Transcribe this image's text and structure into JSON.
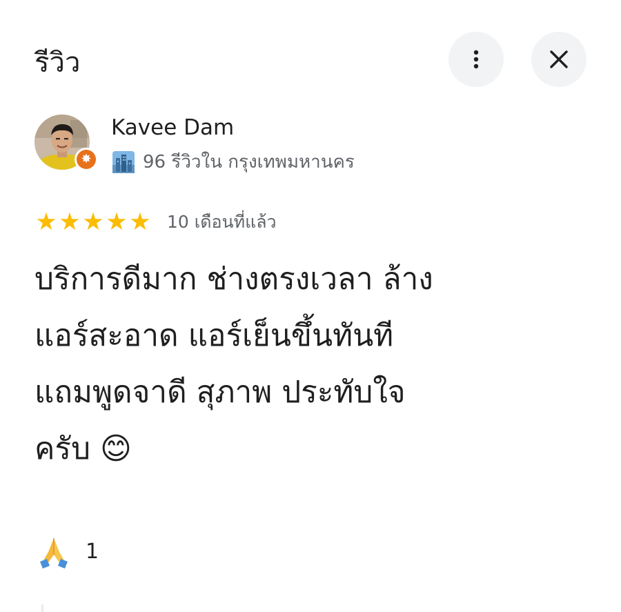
{
  "header": {
    "title": "รีวิว",
    "more_icon": "more-vertical-icon",
    "close_icon": "close-icon"
  },
  "reviewer": {
    "name": "Kavee Dam",
    "badge_icon": "local-guide-badge-icon",
    "meta_icon": "cityscape-icon",
    "meta": "96 รีวิวใน กรุงเทพมหานคร"
  },
  "review": {
    "rating": 5,
    "max_rating": 5,
    "date": "10 เดือนที่แล้ว",
    "text": "บริการดีมาก ช่างตรงเวลา ล้าง\nแอร์สะอาด แอร์เย็นขึ้นทันที\nแถมพูดจาดี สุภาพ ประทับใจ\nครับ 😊"
  },
  "reactions": {
    "icon": "folded-hands-icon",
    "count": "1"
  },
  "colors": {
    "star": "#fbbc04",
    "badge": "#e8711c",
    "button_bg": "#f1f3f4",
    "secondary_text": "#5f6368"
  }
}
